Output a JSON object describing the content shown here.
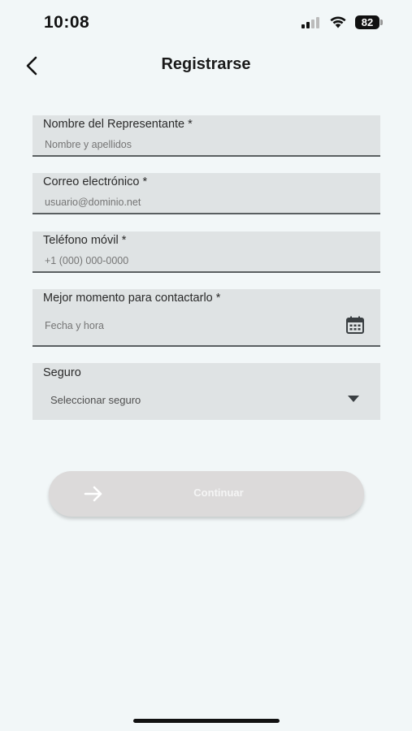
{
  "status_bar": {
    "time": "10:08",
    "battery": "82",
    "icons": [
      "signal-icon",
      "wifi-icon",
      "battery-icon"
    ]
  },
  "header": {
    "title": "Registrarse",
    "back_icon": "chevron-left-icon"
  },
  "form": {
    "name": {
      "label": "Nombre del Representante *",
      "placeholder": "Nombre y apellidos"
    },
    "email": {
      "label": "Correo electrónico *",
      "placeholder": "usuario@dominio.net"
    },
    "phone": {
      "label": "Teléfono móvil *",
      "placeholder": "+1 (000) 000-0000"
    },
    "contact_time": {
      "label": "Mejor momento para contactarlo *",
      "placeholder": "Fecha y hora",
      "icon": "calendar-icon"
    },
    "insurance": {
      "label": "Seguro",
      "value": "Seleccionar seguro",
      "icon": "chevron-down-icon"
    }
  },
  "actions": {
    "continue_label": "Continuar",
    "continue_icon": "arrow-right-icon"
  },
  "colors": {
    "background": "#f2f7f8",
    "field_background": "#dfe3e4",
    "button_disabled": "#dcdada"
  }
}
